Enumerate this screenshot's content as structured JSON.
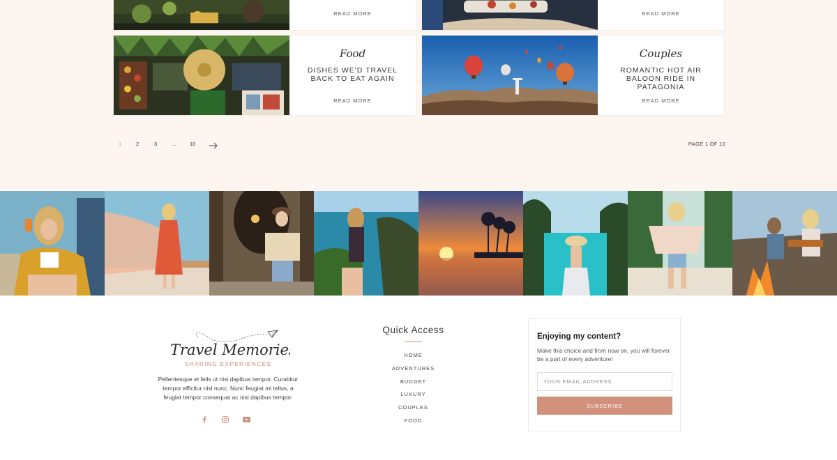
{
  "posts": [
    {
      "title": "",
      "category": "",
      "read_more": "READ MORE"
    },
    {
      "title": "",
      "category": "",
      "read_more": "READ MORE"
    },
    {
      "category": "Food",
      "title": "DISHES WE'D TRAVEL BACK TO EAT AGAIN",
      "read_more": "READ MORE"
    },
    {
      "category": "Couples",
      "title": "ROMANTIC HOT AIR BALOON RIDE IN PATAGONIA",
      "read_more": "READ MORE"
    }
  ],
  "pagination": {
    "pages": [
      "1",
      "2",
      "3",
      "...",
      "10"
    ],
    "current": "1",
    "next_icon": "arrow-right-icon",
    "status": "PAGE 1 OF 10"
  },
  "instagram_feed": {
    "count": 8
  },
  "footer": {
    "brand": "Travel Memories",
    "tagline": "SHARING EXPERIENCES",
    "about": "Pellentesque et felis ut nisi dapibus tempor. Curabitur tempor efficitur nisl nunc. Nunc feugiat mi tellus, a feugiat tempor consequat ac nisi dapibus tempor.",
    "socials": [
      "facebook-icon",
      "instagram-icon",
      "youtube-icon"
    ],
    "quick_access": {
      "title": "Quick Access",
      "links": [
        "HOME",
        "ADVENTURES",
        "BUDGET",
        "LUXURY",
        "COUPLES",
        "FOOD"
      ]
    },
    "newsletter": {
      "title": "Enjoying my content?",
      "text": "Make this choice and from now on, you will forever be a part of every adventure!",
      "placeholder": "YOUR EMAIL ADDRESS",
      "button": "SUBSCRIBE"
    }
  },
  "colors": {
    "accent": "#d2917b",
    "section_bg": "#fdf6f0"
  }
}
